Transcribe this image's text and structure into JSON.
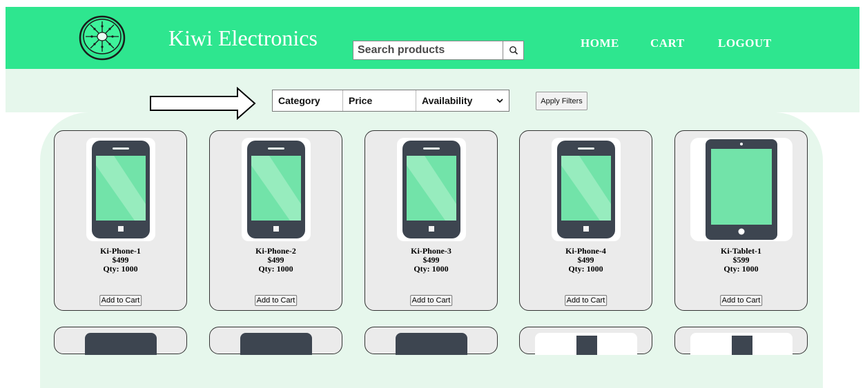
{
  "header": {
    "brand": "Kiwi Electronics",
    "logo_icon": "kiwi-fruit-logo",
    "background_color": "#2ee68f",
    "nav": [
      {
        "label": "HOME"
      },
      {
        "label": "CART"
      },
      {
        "label": "LOGOUT"
      }
    ]
  },
  "search": {
    "placeholder": "Search products",
    "value": "",
    "button_icon": "search-icon"
  },
  "filters": {
    "category_label": "Category",
    "price_label": "Price",
    "availability_label": "Availability",
    "apply_label": "Apply Filters",
    "arrow_icon": "right-arrow-icon"
  },
  "products": [
    {
      "name": "Ki-Phone-1",
      "price": "$499",
      "qty": "Qty: 1000",
      "type": "phone",
      "add_label": "Add to Cart"
    },
    {
      "name": "Ki-Phone-2",
      "price": "$499",
      "qty": "Qty: 1000",
      "type": "phone",
      "add_label": "Add to Cart"
    },
    {
      "name": "Ki-Phone-3",
      "price": "$499",
      "qty": "Qty: 1000",
      "type": "phone",
      "add_label": "Add to Cart"
    },
    {
      "name": "Ki-Phone-4",
      "price": "$499",
      "qty": "Qty: 1000",
      "type": "phone",
      "add_label": "Add to Cart"
    },
    {
      "name": "Ki-Tablet-1",
      "price": "$599",
      "qty": "Qty: 1000",
      "type": "tablet",
      "add_label": "Add to Cart"
    }
  ],
  "colors": {
    "accent": "#2ee68f",
    "panel": "#e6f7ec",
    "card": "#ebebeb",
    "device_screen": "#72e3a9",
    "device_body": "#3d4550"
  }
}
